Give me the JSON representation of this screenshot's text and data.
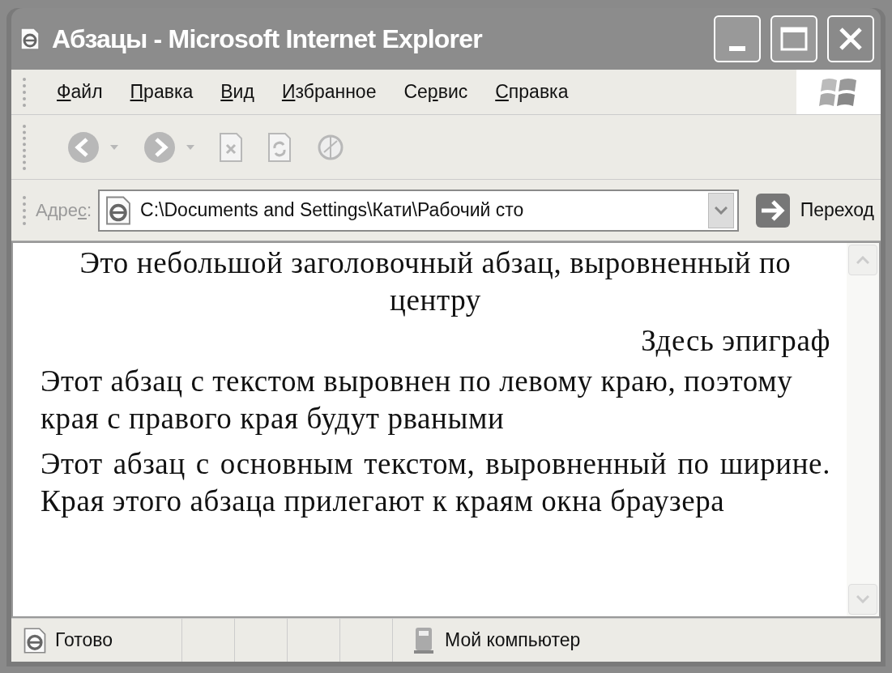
{
  "window": {
    "title": "Абзацы - Microsoft Internet Explorer"
  },
  "menu": [
    {
      "key": "Ф",
      "after": "айл"
    },
    {
      "key": "П",
      "after": "равка"
    },
    {
      "key": "В",
      "after": "ид"
    },
    {
      "key": "И",
      "after": "збранное"
    },
    {
      "before": "Се",
      "key": "р",
      "after": "вис"
    },
    {
      "key": "С",
      "after": "правка"
    }
  ],
  "toolbar": [
    {
      "kind": "back",
      "disabled": true
    },
    {
      "kind": "forward",
      "disabled": true
    },
    {
      "kind": "stop",
      "disabled": true
    },
    {
      "kind": "refresh",
      "disabled": true
    },
    {
      "kind": "home",
      "disabled": true
    }
  ],
  "address": {
    "label": {
      "before": "Адре",
      "key": "с",
      "after": ":"
    },
    "value": "C:\\Documents and Settings\\Кати\\Рабочий сто",
    "go": "Переход"
  },
  "paragraphs": [
    {
      "kind": "centered",
      "text": "Это небольшой заголовочный абзац, выровненный по центру"
    },
    {
      "kind": "flush-right",
      "text": "Здесь эпиграф"
    },
    {
      "kind": "flush-left",
      "text": "Этот абзац с текстом выровнен по левому краю, поэтому края с правого края будут рваными"
    },
    {
      "kind": "justified",
      "text": "Этот абзац с основным текстом, выровненный по ширине. Края этого абзаца прилегают к краям окна браузера"
    }
  ],
  "status_bar": {
    "status": "Готово",
    "zone": "Мой компьютер"
  }
}
